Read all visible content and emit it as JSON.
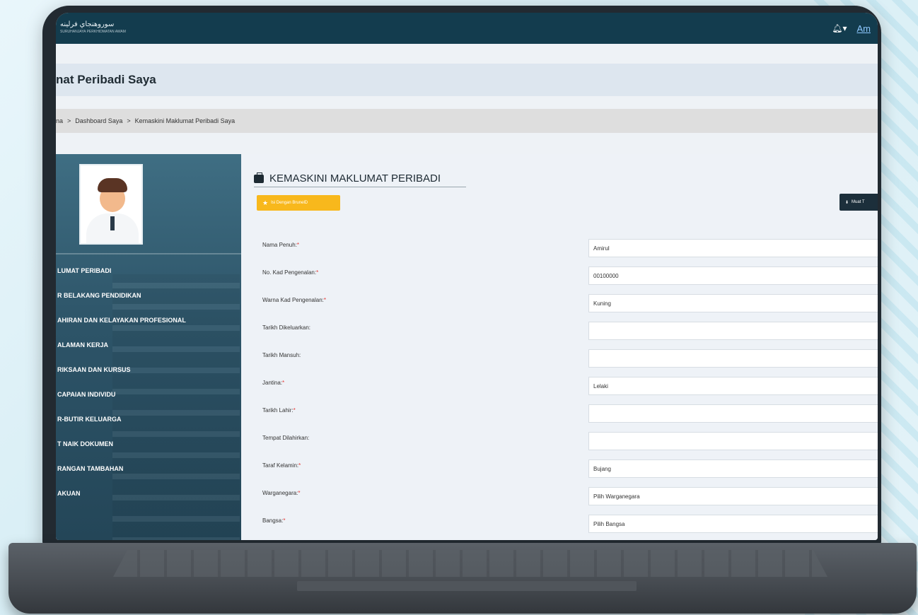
{
  "header": {
    "logo_text": "سوروهنجاي فرلينه",
    "logo_subtext": "SURUHANJAYA PERKHIDMATAN AWAM",
    "user_menu": "Am"
  },
  "page": {
    "title": "nat Peribadi Saya",
    "breadcrumb": [
      "na",
      ">",
      "Dashboard Saya",
      ">",
      "Kemaskini Maklumat Peribadi Saya"
    ]
  },
  "sidebar": {
    "items": [
      {
        "label": "LUMAT PERIBADI"
      },
      {
        "label": "R BELAKANG PENDIDIKAN"
      },
      {
        "label": "AHIRAN DAN KELAYAKAN PROFESIONAL"
      },
      {
        "label": "ALAMAN KERJA"
      },
      {
        "label": "RIKSAAN DAN KURSUS"
      },
      {
        "label": "CAPAIAN INDIVIDU"
      },
      {
        "label": "R-BUTIR KELUARGA"
      },
      {
        "label": "T NAIK DOKUMEN"
      },
      {
        "label": "RANGAN TAMBAHAN"
      },
      {
        "label": "AKUAN"
      }
    ]
  },
  "main": {
    "section_title": "KEMASKINI MAKLUMAT PERIBADI",
    "yellow_button": "Isi Dengan BrunelD",
    "dark_button": "Muat T",
    "fields": [
      {
        "label": "Nama Penuh:",
        "required": "*",
        "value": "Amirul"
      },
      {
        "label": "No. Kad Pengenalan:",
        "required": "*",
        "value": "00100000"
      },
      {
        "label": "Warna Kad Pengenalan:",
        "required": "*",
        "value": "Kuning"
      },
      {
        "label": "Tarikh Dikeluarkan:",
        "required": "",
        "value": ""
      },
      {
        "label": "Tarikh Mansuh:",
        "required": "",
        "value": ""
      },
      {
        "label": "Jantina:",
        "required": "*",
        "value": "Lelaki"
      },
      {
        "label": "Tarikh Lahir:",
        "required": "*",
        "value": ""
      },
      {
        "label": "Tempat Dilahirkan:",
        "required": "",
        "value": ""
      },
      {
        "label": "Taraf Kelamin:",
        "required": "*",
        "value": "Bujang"
      },
      {
        "label": "Warganegara:",
        "required": "*",
        "value": "Pilih Warganegara"
      },
      {
        "label": "Bangsa:",
        "required": "*",
        "value": "Pilih Bangsa"
      }
    ]
  },
  "colors": {
    "topbar": "#133c4e",
    "sidebar": "#2d5468",
    "accent_yellow": "#f8b81c",
    "required": "#e53935"
  }
}
